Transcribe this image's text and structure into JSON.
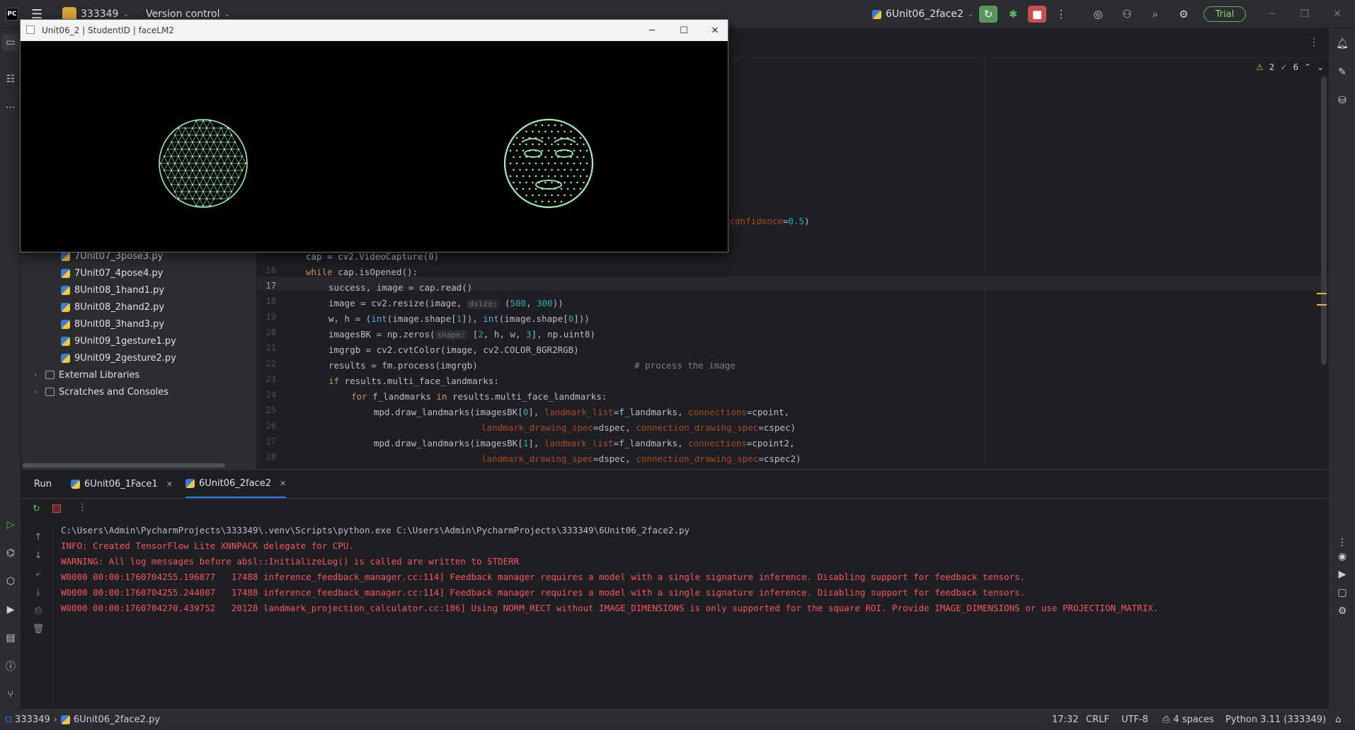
{
  "titlebar": {
    "project_name": "333349",
    "vcs_label": "Version control",
    "run_config": "6Unit06_2face2",
    "trial_label": "Trial"
  },
  "project_tree": {
    "items": [
      {
        "label": "7Unit07_3pose3.py"
      },
      {
        "label": "7Unit07_4pose4.py"
      },
      {
        "label": "8Unit08_1hand1.py"
      },
      {
        "label": "8Unit08_2hand2.py"
      },
      {
        "label": "8Unit08_3hand3.py"
      },
      {
        "label": "9Unit09_1gesture1.py"
      },
      {
        "label": "9Unit09_2gesture2.py"
      }
    ],
    "external_libraries": "External Libraries",
    "scratches": "Scratches and Consoles"
  },
  "editor": {
    "inspections": {
      "warnings": "2",
      "ok": "6"
    },
    "partial_line": {
      "text": "ng_confidence",
      "op": "=",
      "value": "0.5",
      "close": ")"
    },
    "line_numbers": [
      "16",
      "17",
      "18",
      "19",
      "20",
      "21",
      "22",
      "23",
      "24",
      "25",
      "26",
      "27",
      "28"
    ],
    "lines": {
      "l15": "cap = cv2.VideoCapture(0)",
      "l16_kw": "while",
      "l16": " cap.isOpened():",
      "l17": "success, image = cap.read()",
      "l18_a": "image = cv2.resize(image, ",
      "l18_hint": "dsize:",
      "l18_b": " (",
      "l18_n1": "500",
      "l18_c": ", ",
      "l18_n2": "300",
      "l18_d": "))",
      "l19_a": "w, h = (",
      "l19_f1": "int",
      "l19_b": "(image.shape[",
      "l19_n1": "1",
      "l19_c": "]), ",
      "l19_f2": "int",
      "l19_d": "(image.shape[",
      "l19_n2": "0",
      "l19_e": "]))",
      "l20_a": "imagesBK = np.zeros(",
      "l20_hint": "shape:",
      "l20_b": " [",
      "l20_n1": "2",
      "l20_c": ", h, w, ",
      "l20_n2": "3",
      "l20_d": "], np.uint8)",
      "l21": "imgrgb = cv2.cvtColor(image, cv2.COLOR_BGR2RGB)",
      "l22_a": "results = fm.process(imgrgb)",
      "l22_cmt": "# process the image",
      "l23_kw": "if",
      "l23": " results.multi_face_landmarks:",
      "l24_kw1": "for",
      "l24_a": " f_landmarks ",
      "l24_kw2": "in",
      "l24_b": " results.multi_face_landmarks:",
      "l25_a": "mpd.draw_landmarks(imagesBK[",
      "l25_n": "0",
      "l25_b": "], ",
      "l25_p1": "landmark_list",
      "l25_c": "=f_landmarks, ",
      "l25_p2": "connections",
      "l25_d": "=cpoint,",
      "l26_p1": "landmark_drawing_spec",
      "l26_a": "=dspec, ",
      "l26_p2": "connection_drawing_spec",
      "l26_b": "=cspec)",
      "l27_a": "mpd.draw_landmarks(imagesBK[",
      "l27_n": "1",
      "l27_b": "], ",
      "l27_p1": "landmark_list",
      "l27_c": "=f_landmarks, ",
      "l27_p2": "connections",
      "l27_d": "=cpoint2,",
      "l28_p1": "landmark_drawing_spec",
      "l28_a": "=dspec, ",
      "l28_p2": "connection_drawing_spec",
      "l28_b": "=cspec2)"
    }
  },
  "run_panel": {
    "title": "Run",
    "tabs": [
      {
        "label": "6Unit06_1Face1"
      },
      {
        "label": "6Unit06_2face2"
      }
    ],
    "console": [
      {
        "text": "C:\\Users\\Admin\\PycharmProjects\\333349\\.venv\\Scripts\\python.exe C:\\Users\\Admin\\PycharmProjects\\333349\\6Unit06_2face2.py",
        "color": "#bcbec4"
      },
      {
        "text": "INFO: Created TensorFlow Lite XNNPACK delegate for CPU.",
        "color": "#f75464"
      },
      {
        "text": "WARNING: All log messages before absl::InitializeLog() is called are written to STDERR",
        "color": "#f75464"
      },
      {
        "text": "W0000 00:00:1760704255.196877   17488 inference_feedback_manager.cc:114] Feedback manager requires a model with a single signature inference. Disabling support for feedback tensors.",
        "color": "#f75464"
      },
      {
        "text": "W0000 00:00:1760704255.244007   17488 inference_feedback_manager.cc:114] Feedback manager requires a model with a single signature inference. Disabling support for feedback tensors.",
        "color": "#f75464"
      },
      {
        "text": "W0000 00:00:1760704270.439752   20128 landmark_projection_calculator.cc:186] Using NORM_RECT without IMAGE_DIMENSIONS is only supported for the square ROI. Provide IMAGE_DIMENSIONS or use PROJECTION_MATRIX.",
        "color": "#f75464"
      }
    ]
  },
  "statusbar": {
    "project": "333349",
    "file": "6Unit06_2face2.py",
    "position": "17:32",
    "line_sep": "CRLF",
    "encoding": "UTF-8",
    "indent": "4 spaces",
    "interpreter": "Python 3.11 (333349)"
  },
  "cv_window": {
    "title": "Unit06_2 | StudentID | faceLM2",
    "mesh_color": "#9ef0b4"
  }
}
